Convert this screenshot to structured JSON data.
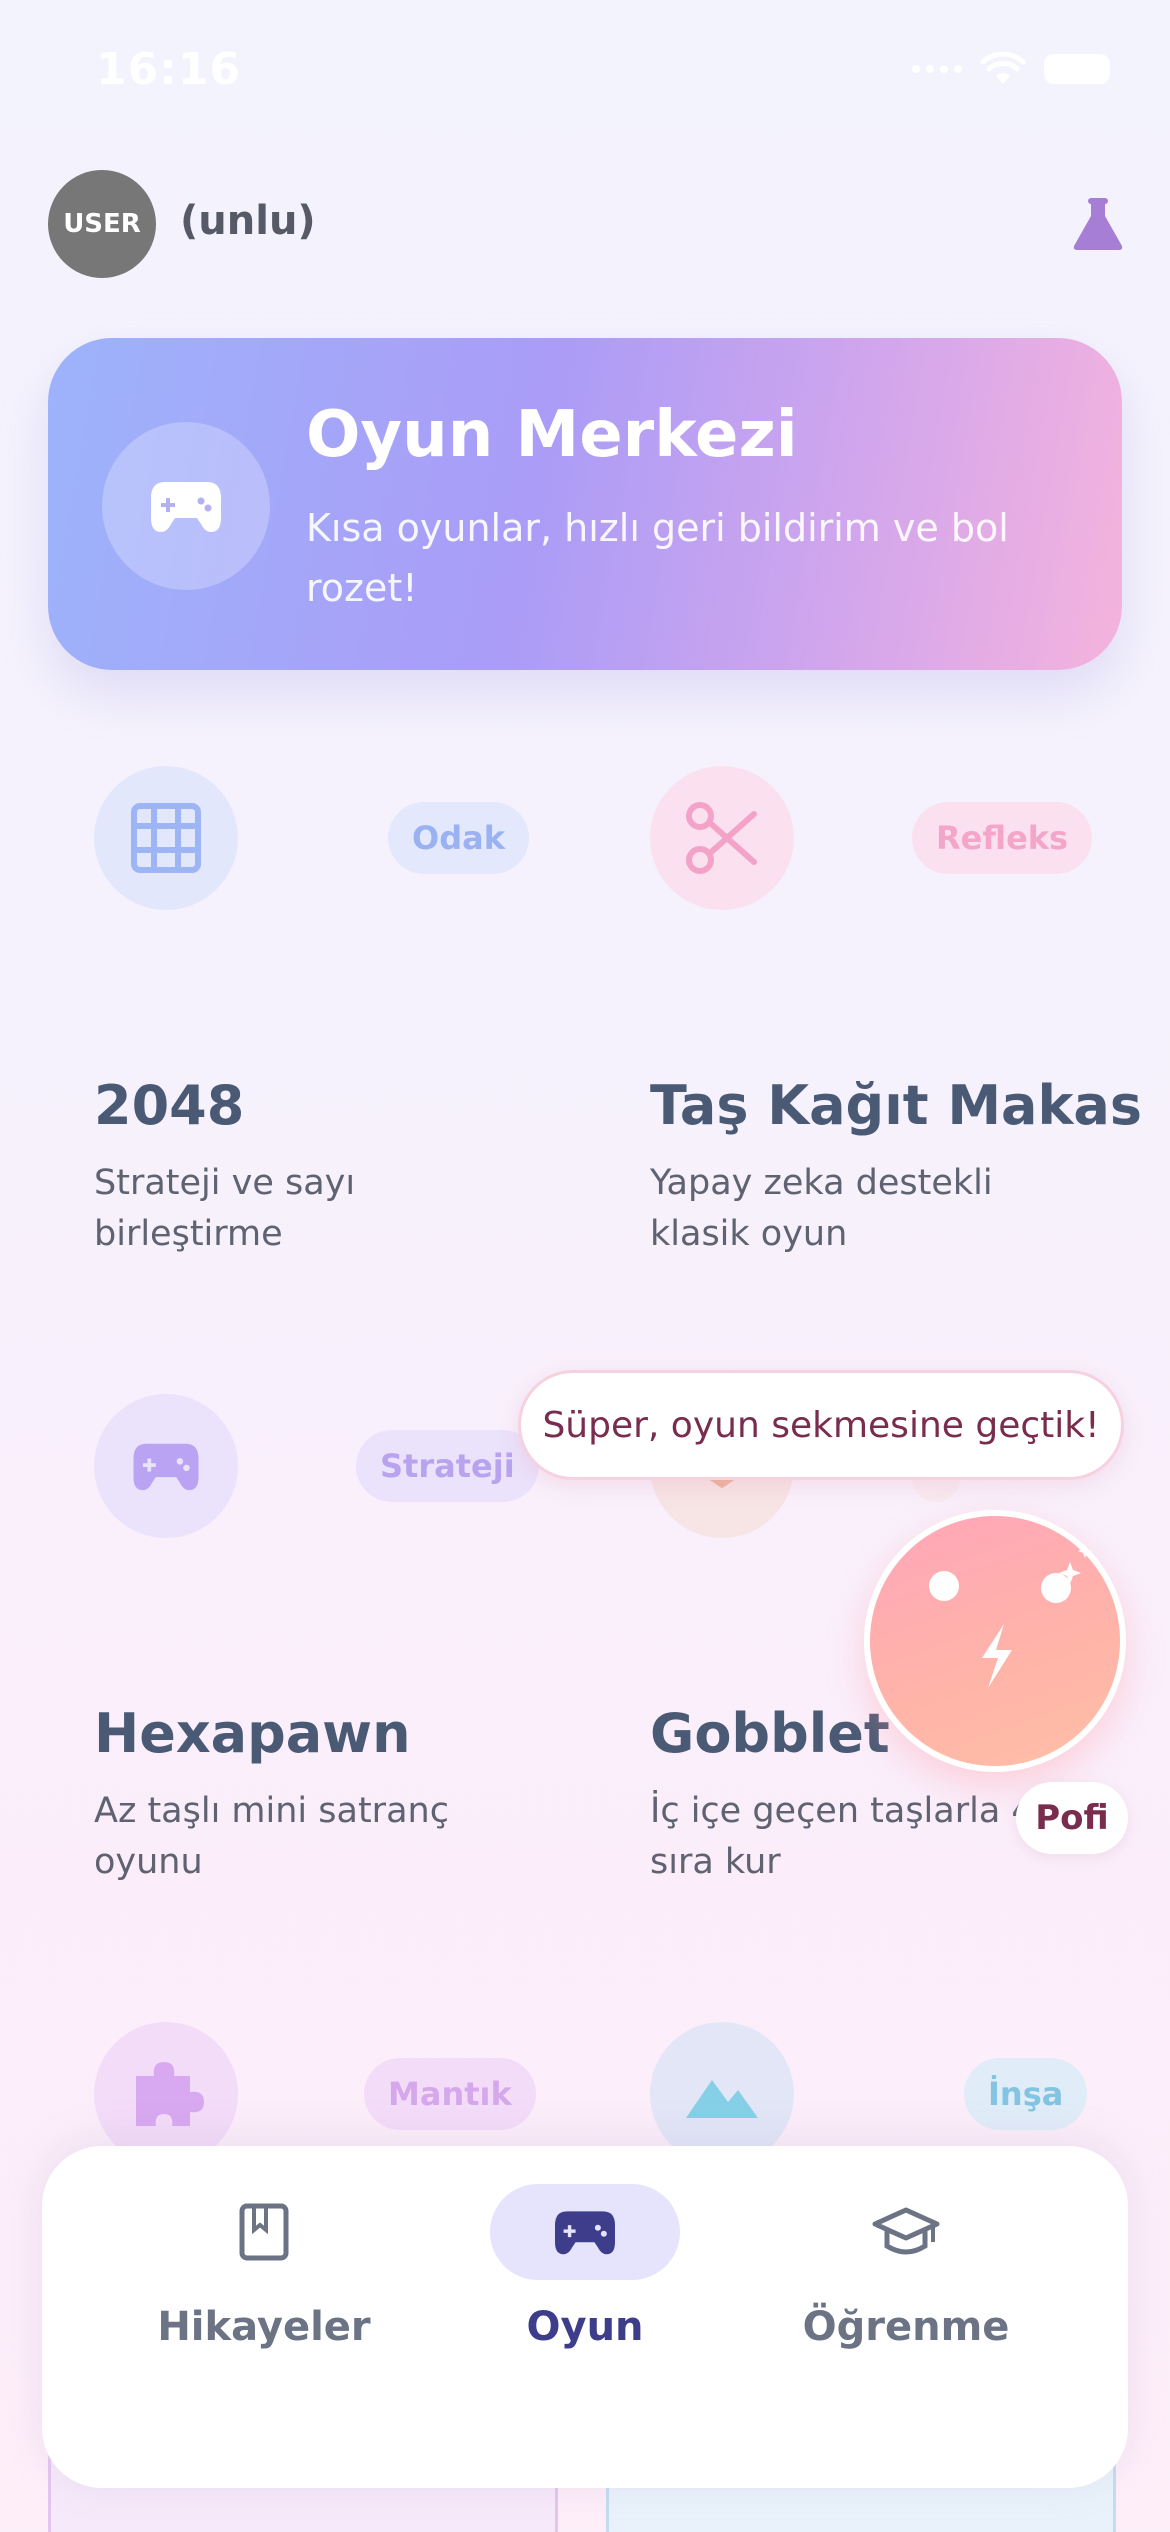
{
  "status_bar": {
    "time": "16:16"
  },
  "header": {
    "avatar_text": "USER",
    "username": "(unlu)"
  },
  "hero": {
    "title": "Oyun Merkezi",
    "subtitle": "Kısa oyunlar, hızlı geri bildirim ve bol rozet!"
  },
  "games": [
    {
      "title": "2048",
      "description": "Strateji ve sayı birleştirme",
      "tag": "Odak",
      "icon": "grid-icon"
    },
    {
      "title": "Taş Kağıt Makas",
      "description": "Yapay zeka destekli klasik oyun",
      "tag": "Refleks",
      "icon": "scissors-icon"
    },
    {
      "title": "Hexapawn",
      "description": "Az taşlı mini satranç oyunu",
      "tag": "Strateji",
      "icon": "gamepad-icon"
    },
    {
      "title": "Gobblet",
      "description": "İç içe geçen taşlarla 4'ü sıra kur",
      "tag": "",
      "icon": "chevron-icon"
    },
    {
      "title": "",
      "description": "",
      "tag": "Mantık",
      "icon": "puzzle-icon"
    },
    {
      "title": "",
      "description": "",
      "tag": "İnşa",
      "icon": "mountain-icon"
    }
  ],
  "assistant": {
    "message": "Süper, oyun sekmesine geçtik!",
    "name": "Pofi"
  },
  "tabs": [
    {
      "label": "Hikayeler",
      "icon": "book-icon",
      "active": false
    },
    {
      "label": "Oyun",
      "icon": "gamepad-icon",
      "active": true
    },
    {
      "label": "Öğrenme",
      "icon": "graduation-cap-icon",
      "active": false
    }
  ],
  "colors": {
    "accent": "#3d3d8c",
    "hero_start": "#9db3fb",
    "hero_end": "#f5b3dd",
    "mascot": "#ffa6b9"
  }
}
